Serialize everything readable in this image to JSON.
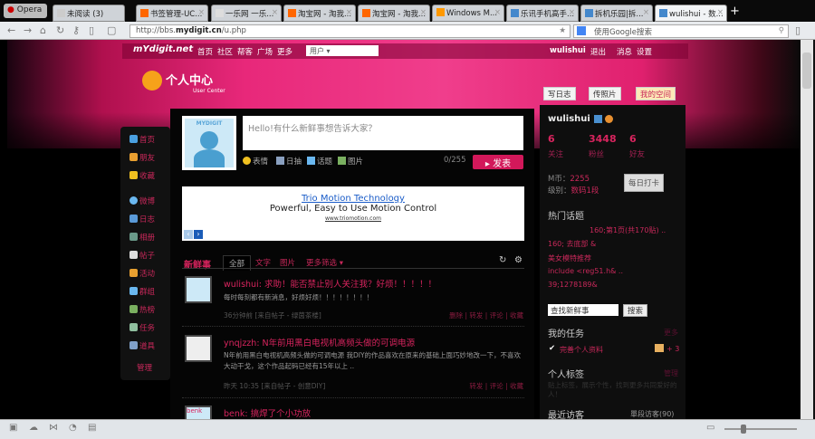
{
  "browser": {
    "menu": "Opera",
    "tabs": [
      "未阅读 (3)",
      "书签管理-UC...",
      "一乐网 一乐...",
      "淘宝网 - 淘我...",
      "淘宝网 - 淘我...",
      "Windows M...",
      "乐讯手机高手...",
      "拆机乐园|拆...",
      "wulishui - 数..."
    ],
    "url_prefix": "http://bbs.",
    "url_domain": "mydigit.cn",
    "url_path": "/u.php",
    "search_placeholder": "使用Google搜索"
  },
  "topnav": {
    "logo": "mYdigit.net",
    "links": [
      "首页",
      "社区",
      "帮客",
      "广场",
      "更多"
    ],
    "user_select": "用户 ▾",
    "username": "wulishui",
    "logout": "退出",
    "messages": "消息",
    "settings": "设置"
  },
  "ucenter": {
    "title": "个人中心",
    "subtitle": "User Center"
  },
  "sidebar": {
    "items": [
      "首页",
      "朋友",
      "收藏",
      "微博",
      "日志",
      "相册",
      "帖子",
      "活动",
      "群组",
      "热榜",
      "任务",
      "道具"
    ],
    "admin": "管理"
  },
  "composer": {
    "avatar_label": "MYDIGIT",
    "placeholder": "Hello!有什么新鲜事想告诉大家？",
    "tools": [
      "表情",
      "日抽",
      "话题",
      "图片"
    ],
    "count": "0/255",
    "submit": "▸ 发表"
  },
  "ad": {
    "title": "Trio Motion Technology",
    "tagline": "Powerful, Easy to Use Motion Control",
    "url": "www.triomotion.com"
  },
  "feed": {
    "title": "新鲜事",
    "tabs": [
      "全部",
      "文字",
      "图片",
      "更多筛选 ▾"
    ],
    "items": [
      {
        "author": "wulishui",
        "title": "求助！能否禁止别人关注我？好烦！！！！！",
        "body": "每时每刻都有新消息，好烦好烦！！！！！！！！",
        "meta": "36分钟前 [来自帖子 - 绿茵茶楼]",
        "actions": [
          "删除",
          "转发",
          "评论",
          "收藏"
        ]
      },
      {
        "author": "ynqjzzh",
        "title": "N年前用黑白电视机高频头做的可调电源",
        "body": "N年前用黑白电视机高频头做的可调电源 我DIY的作品喜欢在原来的基础上面巧妙地改一下，不喜欢大动干戈，这个作品起码已经有15年以上 ..",
        "meta": "昨天 10:35 [来自帖子 - 创意DIY]",
        "actions": [
          "转发",
          "评论",
          "收藏"
        ]
      },
      {
        "author": "benk",
        "title": "搞焊了个小功放",
        "avatar_label": "benk"
      }
    ]
  },
  "actions": {
    "write_blog": "写日志",
    "upload_photo": "传照片",
    "my_space": "我的空间"
  },
  "profile": {
    "name": "wulishui",
    "stats": [
      {
        "value": "6",
        "label": "关注"
      },
      {
        "value": "3448",
        "label": "粉丝"
      },
      {
        "value": "6",
        "label": "好友"
      }
    ],
    "coins_label": "M币：",
    "coins": "2255",
    "level_label": "级别：",
    "level": "数码1段",
    "checkin": "每日打卡"
  },
  "hot_topics": {
    "title": "热门话题",
    "items": [
      "160;第1页(共170贴) ..",
      "160; 去底部 &",
      "美女模特推荐",
      "include <reg51.h& ..",
      "39;1278189&"
    ]
  },
  "search": {
    "value": "查找新鲜事",
    "button": "搜索"
  },
  "tasks": {
    "title": "我的任务",
    "more": "更多",
    "item": "完善个人资料",
    "reward": "+ 3"
  },
  "tags": {
    "title": "个人标签",
    "manage": "管理",
    "hint": "贴上标签，展示个性，找到更多共同爱好的人！"
  },
  "visitors": {
    "title": "最近访客",
    "count": "單段访客(90)"
  }
}
